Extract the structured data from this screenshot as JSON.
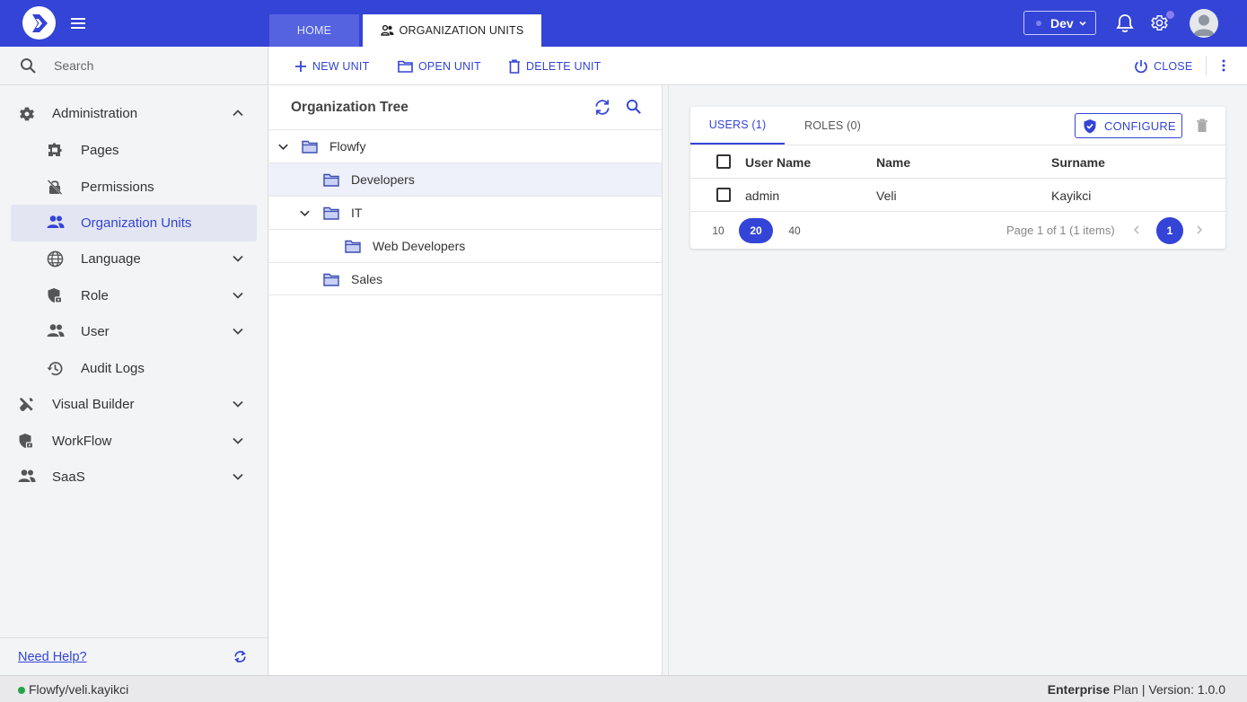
{
  "header": {
    "tabs": [
      {
        "label": "HOME"
      },
      {
        "label": "ORGANIZATION UNITS"
      }
    ],
    "environment": "Dev",
    "colors": {
      "brand": "#3344d6",
      "brand_light": "#5563e0"
    }
  },
  "sidebar": {
    "search": {
      "placeholder": "Search"
    },
    "items": [
      {
        "label": "Administration",
        "icon": "gear-icon",
        "expanded": true
      },
      {
        "label": "Pages",
        "icon": "puzzle-icon"
      },
      {
        "label": "Permissions",
        "icon": "lock-off-icon"
      },
      {
        "label": "Organization Units",
        "icon": "people-icon",
        "active": true
      },
      {
        "label": "Language",
        "icon": "globe-icon"
      },
      {
        "label": "Role",
        "icon": "shield-lock-icon"
      },
      {
        "label": "User",
        "icon": "people-icon"
      },
      {
        "label": "Audit Logs",
        "icon": "history-icon"
      },
      {
        "label": "Visual Builder",
        "icon": "tools-icon"
      },
      {
        "label": "WorkFlow",
        "icon": "shield-lock-icon"
      },
      {
        "label": "SaaS",
        "icon": "people-icon"
      }
    ],
    "help_link": "Need Help?"
  },
  "toolbar": {
    "new_unit": "NEW UNIT",
    "open_unit": "OPEN UNIT",
    "delete_unit": "DELETE UNIT",
    "close": "CLOSE"
  },
  "tree": {
    "title": "Organization Tree",
    "nodes": [
      {
        "name": "Flowfy",
        "level": 0,
        "expanded": true
      },
      {
        "name": "Developers",
        "level": 1,
        "selected": true
      },
      {
        "name": "IT",
        "level": 1,
        "expanded": true
      },
      {
        "name": "Web Developers",
        "level": 2
      },
      {
        "name": "Sales",
        "level": 1
      }
    ]
  },
  "detail": {
    "tabs": [
      {
        "label": "USERS (1)",
        "active": true
      },
      {
        "label": "ROLES (0)"
      }
    ],
    "configure_label": "CONFIGURE",
    "columns": [
      "User Name",
      "Name",
      "Surname"
    ],
    "rows": [
      {
        "user_name": "admin",
        "name": "Veli",
        "surname": "Kayikci"
      }
    ],
    "pager": {
      "page_sizes": [
        "10",
        "20",
        "40"
      ],
      "active_size": "20",
      "info": "Page 1 of 1 (1 items)",
      "current_page": "1"
    }
  },
  "status": {
    "user": "Flowfy/veli.kayikci",
    "plan_bold": "Enterprise",
    "plan_rest": " Plan | Version: 1.0.0"
  }
}
